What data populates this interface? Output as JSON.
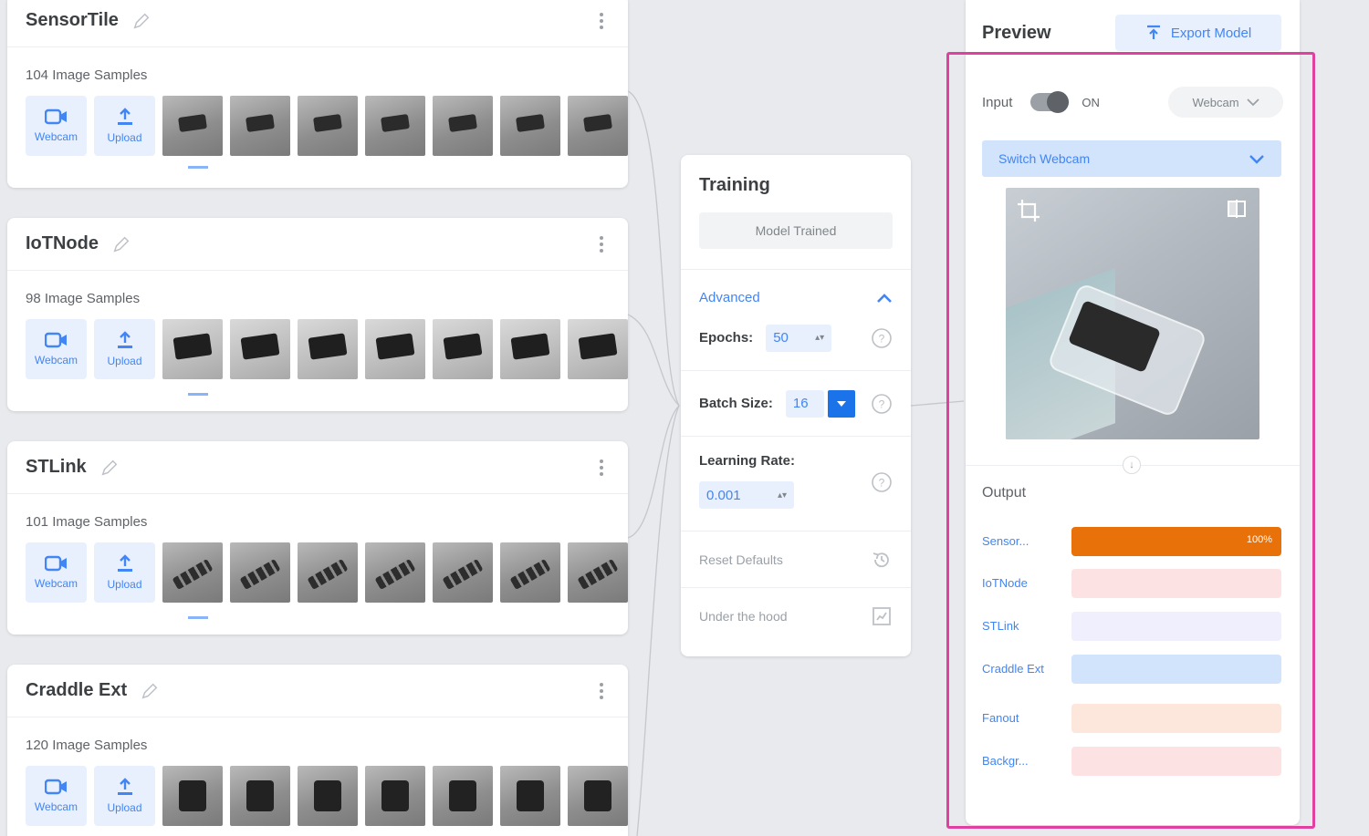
{
  "classes": [
    {
      "name": "SensorTile",
      "samples": "104 Image Samples",
      "webcam_label": "Webcam",
      "upload_label": "Upload"
    },
    {
      "name": "IoTNode",
      "samples": "98 Image Samples",
      "webcam_label": "Webcam",
      "upload_label": "Upload"
    },
    {
      "name": "STLink",
      "samples": "101 Image Samples",
      "webcam_label": "Webcam",
      "upload_label": "Upload"
    },
    {
      "name": "Craddle Ext",
      "samples": "120 Image Samples",
      "webcam_label": "Webcam",
      "upload_label": "Upload"
    }
  ],
  "training": {
    "title": "Training",
    "model_trained": "Model Trained",
    "advanced": "Advanced",
    "epochs_label": "Epochs:",
    "epochs_value": "50",
    "batch_label": "Batch Size:",
    "batch_value": "16",
    "lr_label": "Learning Rate:",
    "lr_value": "0.001",
    "reset": "Reset Defaults",
    "hood": "Under the hood"
  },
  "preview": {
    "title": "Preview",
    "export": "Export Model",
    "input_label": "Input",
    "on_label": "ON",
    "webcam_select": "Webcam",
    "switch_webcam": "Switch Webcam",
    "output_title": "Output",
    "outputs": [
      {
        "label": "Sensor...",
        "color": "#e8710a",
        "pct": "100%"
      },
      {
        "label": "IoTNode",
        "color": "#fde2e4",
        "pct": ""
      },
      {
        "label": "STLink",
        "color": "#efeffd",
        "pct": ""
      },
      {
        "label": "Craddle Ext",
        "color": "#d2e3fc",
        "pct": ""
      },
      {
        "label": "Fanout",
        "color": "#fde7dc",
        "pct": ""
      },
      {
        "label": "Backgr...",
        "color": "#fde2e4",
        "pct": ""
      }
    ]
  }
}
